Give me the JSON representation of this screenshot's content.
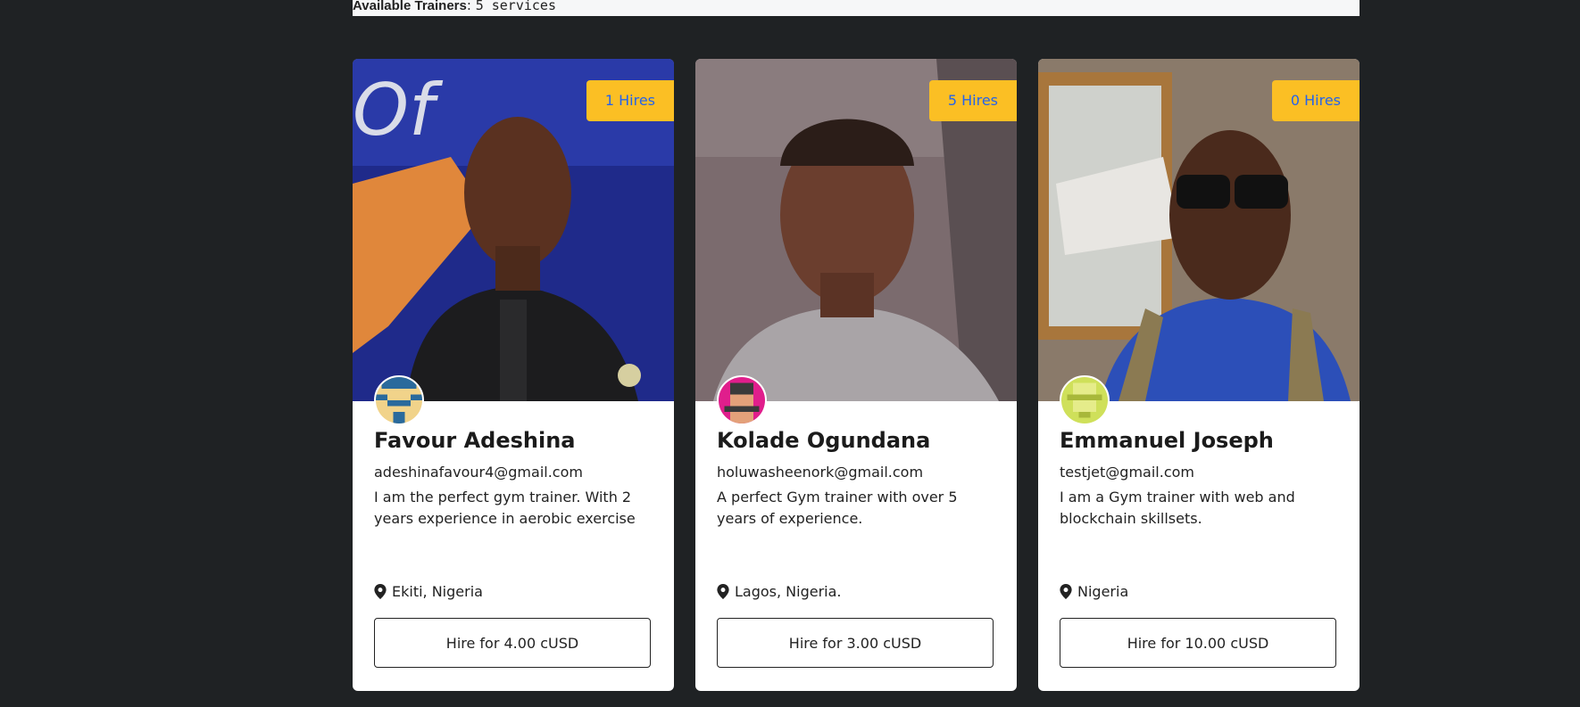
{
  "header": {
    "label": "Available Trainers",
    "value": "5 services"
  },
  "cards": [
    {
      "hires": "1 Hires",
      "name": "Favour Adeshina",
      "email": "adeshinafavour4@gmail.com",
      "description": "I am the perfect gym trainer. With 2 years experience in aerobic exercise",
      "location": "Ekiti, Nigeria",
      "button": "Hire for 4.00 cUSD"
    },
    {
      "hires": "5 Hires",
      "name": "Kolade Ogundana",
      "email": "holuwasheenork@gmail.com",
      "description": "A perfect Gym trainer with over 5 years of experience.",
      "location": "Lagos, Nigeria.",
      "button": "Hire for 3.00 cUSD"
    },
    {
      "hires": "0 Hires",
      "name": "Emmanuel Joseph",
      "email": "testjet@gmail.com",
      "description": "I am a Gym trainer with web and blockchain skillsets.",
      "location": "Nigeria",
      "button": "Hire for 10.00 cUSD"
    }
  ],
  "colors": {
    "background": "#1f2224",
    "badge": "#fbbf24",
    "badge_text": "#2563eb"
  }
}
